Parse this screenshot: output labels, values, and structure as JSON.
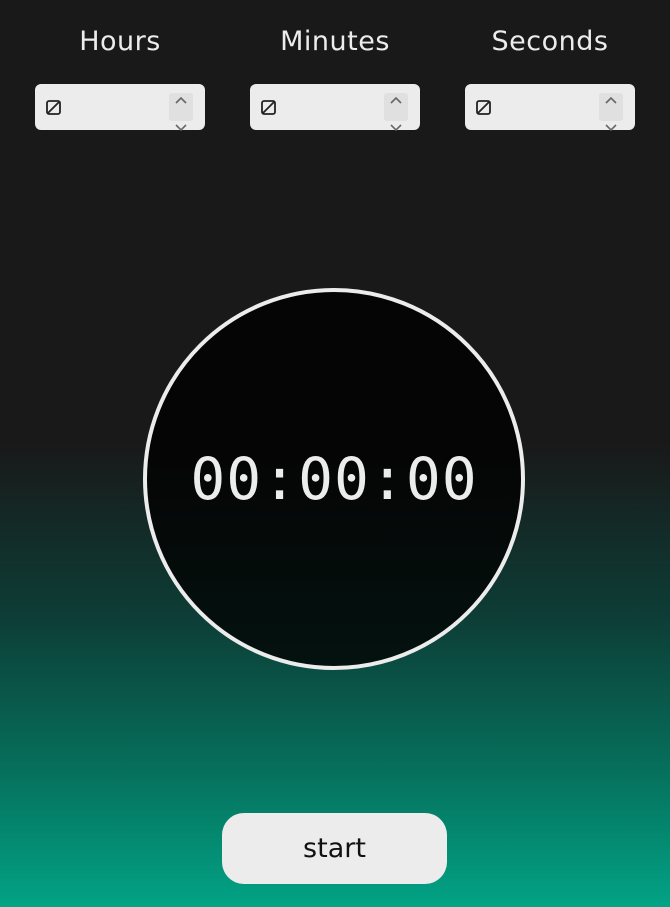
{
  "inputs": [
    {
      "label": "Hours",
      "value": ""
    },
    {
      "label": "Minutes",
      "value": ""
    },
    {
      "label": "Seconds",
      "value": ""
    }
  ],
  "timer": {
    "display": "00:00:00"
  },
  "controls": {
    "start_label": "start"
  },
  "icons": {
    "spinner_up": "chevron-up-icon",
    "spinner_down": "chevron-down-icon",
    "empty_value": "zero-glyph-icon"
  },
  "colors": {
    "background_top": "#191919",
    "background_bottom": "#02a386",
    "foreground": "#ececec",
    "clock_face": "#050505"
  }
}
